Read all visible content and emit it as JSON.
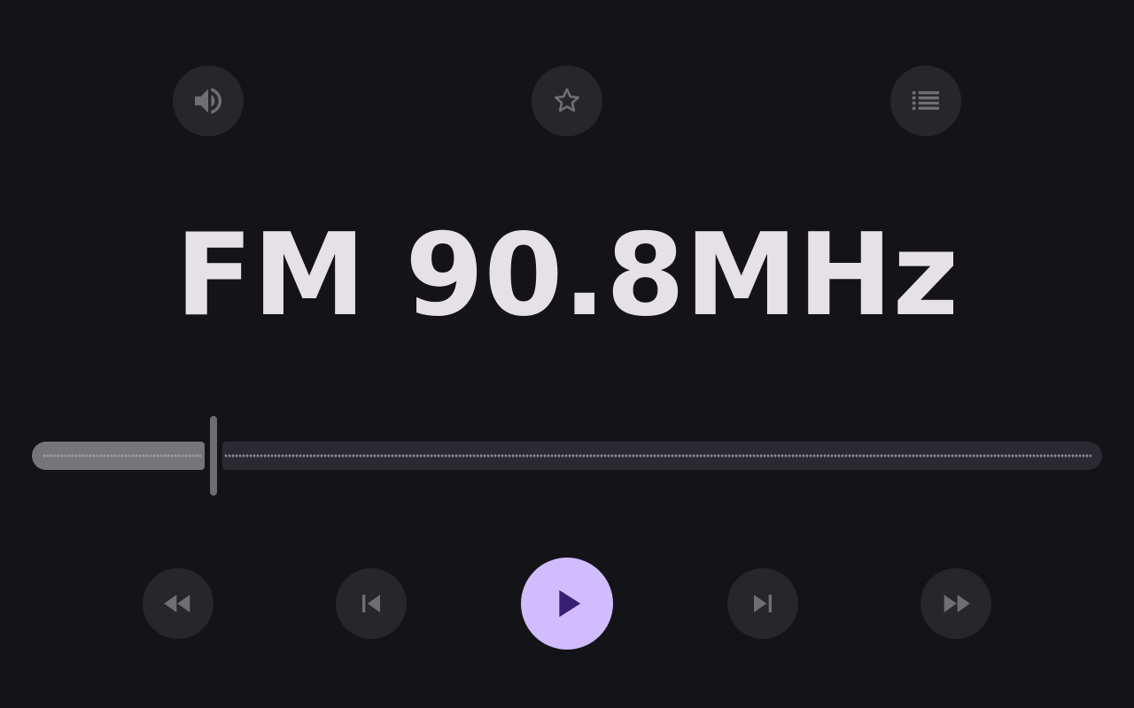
{
  "top_actions": {
    "volume_icon": "volume-up-icon",
    "favorite_icon": "star-outline-icon",
    "list_icon": "station-list-icon"
  },
  "station": {
    "frequency_text": "FM 90.8MHz"
  },
  "tuner": {
    "value": 0.17
  },
  "playback_controls": {
    "rewind_icon": "fast-rewind-icon",
    "previous_icon": "skip-previous-icon",
    "play_icon": "play-icon",
    "next_icon": "skip-next-icon",
    "forward_icon": "fast-forward-icon"
  },
  "colors": {
    "background": "#141318",
    "button_surface": "#27262b",
    "icon": "#6f6e74",
    "frequency_text": "#e6e1e6",
    "play_button": "#d0bcff",
    "play_icon": "#381e72"
  }
}
